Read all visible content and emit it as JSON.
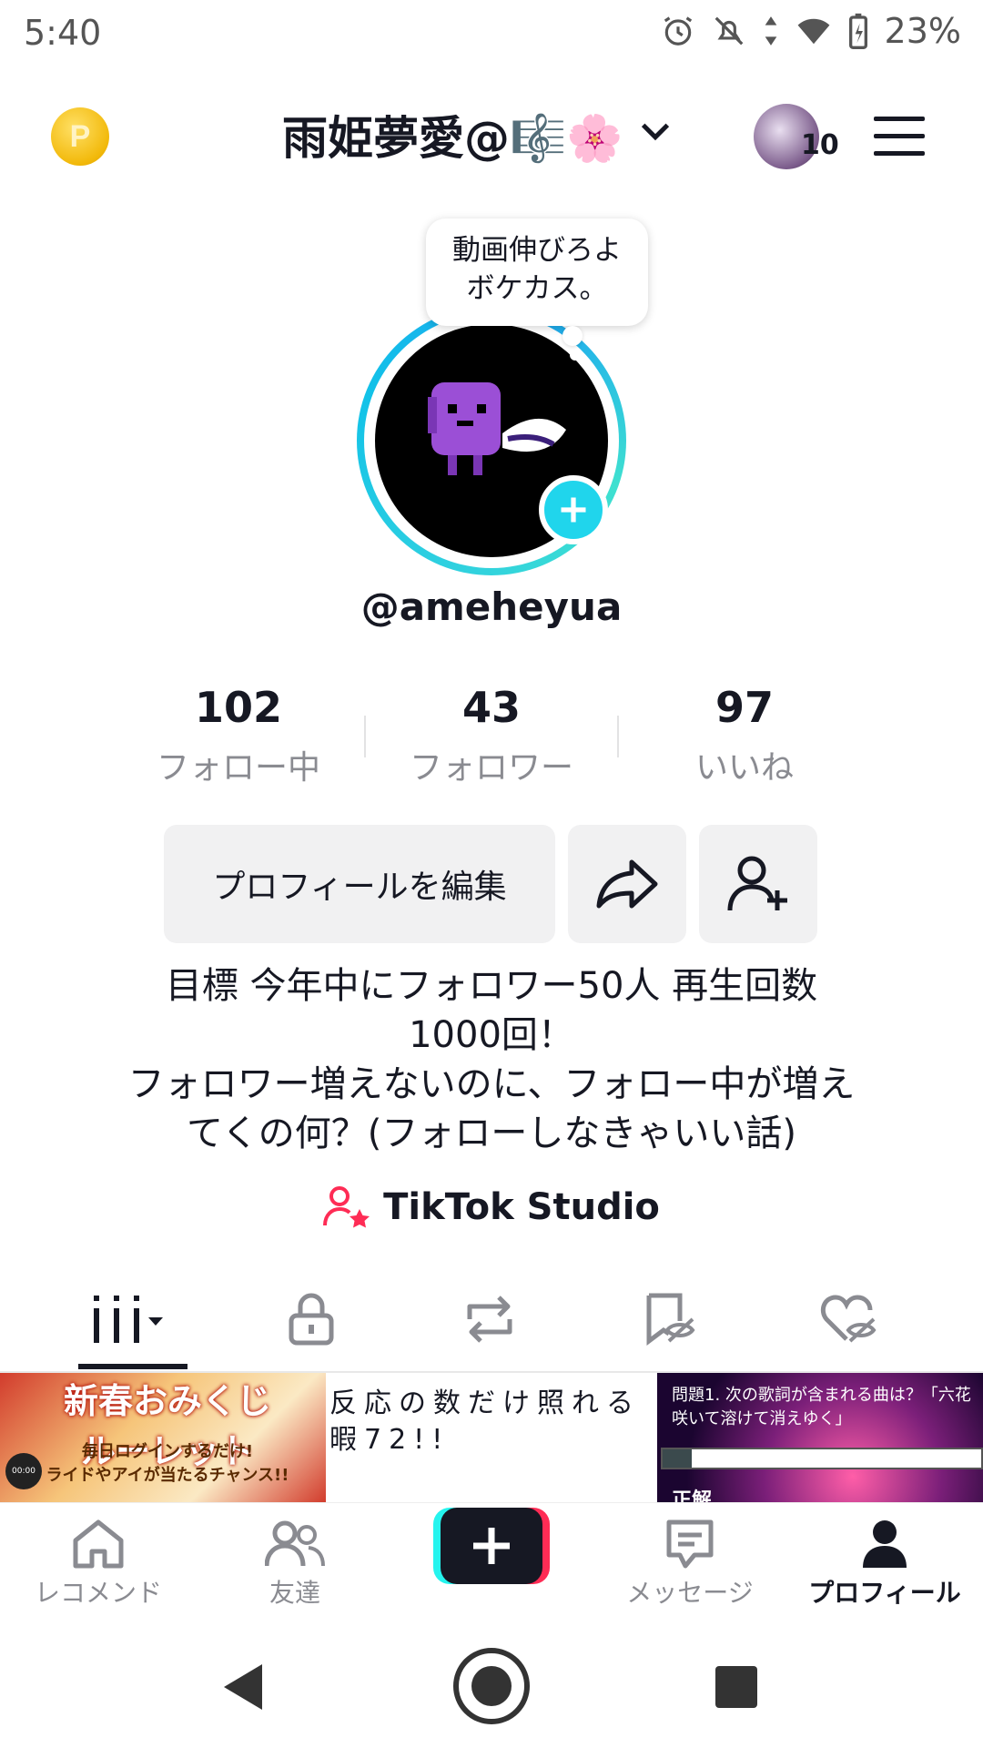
{
  "status_bar": {
    "time": "5:40",
    "battery": "23%"
  },
  "header": {
    "display_name": "雨姫夢愛@🎼🌸",
    "inbox_count": "10",
    "coin_letter": "P"
  },
  "profile": {
    "tooltip": "動画伸びろよ\nボケカス。",
    "username": "@ameheyua",
    "stats": [
      {
        "value": "102",
        "label": "フォロー中"
      },
      {
        "value": "43",
        "label": "フォロワー"
      },
      {
        "value": "97",
        "label": "いいね"
      }
    ],
    "edit_button": "プロフィールを編集",
    "bio": "目標  今年中にフォロワー50人 再生回数\n1000回！\nフォロワー増えないのに、フォロー中が増え\nてくの何？(フォローしなきゃいい話)",
    "studio_label": "TikTok Studio"
  },
  "thumbnails": [
    {
      "title": "新春おみくじ\nルーレット",
      "subtitle": "毎日ログインするだけ!\nライドやアイが当たるチャンス!!",
      "time": "00:00"
    },
    {
      "text": "反応の数だけ照れる\n暇72!!"
    },
    {
      "text": "問題1. 次の歌詞が含まれる曲は？「六花\n咲いて溶けて消えゆく」",
      "progress": 0.09,
      "answer": "正解"
    }
  ],
  "bottom_nav": [
    {
      "label": "レコメンド"
    },
    {
      "label": "友達"
    },
    {
      "label": ""
    },
    {
      "label": "メッセージ"
    },
    {
      "label": "プロフィール"
    }
  ],
  "colors": {
    "accent": "#20d5ec",
    "pink": "#fe2c55",
    "text": "#161823",
    "muted": "#8a8b91"
  }
}
